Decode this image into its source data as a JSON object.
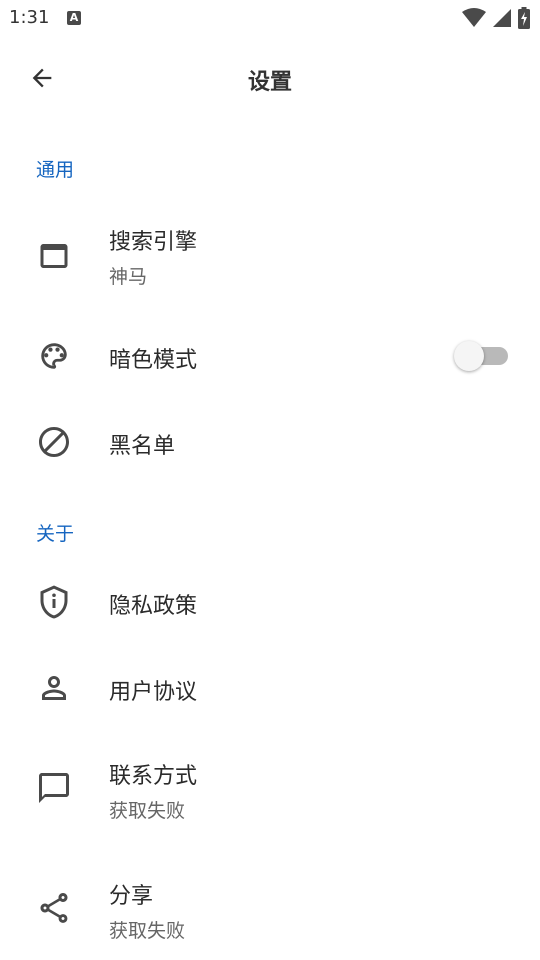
{
  "status_bar": {
    "time": "1:31",
    "notification_icon_letter": "A",
    "icons": [
      "wifi-icon",
      "cell-signal-icon",
      "battery-charging-icon"
    ]
  },
  "app_bar": {
    "title": "设置",
    "back_icon": "arrow-back-icon"
  },
  "sections": {
    "general": {
      "header": "通用",
      "items": {
        "search_engine": {
          "title": "搜索引擎",
          "subtitle": "神马",
          "icon": "browser-window-icon"
        },
        "dark_mode": {
          "title": "暗色模式",
          "icon": "palette-icon",
          "toggle_on": false
        },
        "blacklist": {
          "title": "黑名单",
          "icon": "block-icon"
        }
      }
    },
    "about": {
      "header": "关于",
      "items": {
        "privacy_policy": {
          "title": "隐私政策",
          "icon": "shield-info-icon"
        },
        "user_agreement": {
          "title": "用户协议",
          "icon": "person-icon"
        },
        "contact": {
          "title": "联系方式",
          "subtitle": "获取失败",
          "icon": "chat-bubble-icon"
        },
        "share": {
          "title": "分享",
          "subtitle": "获取失败",
          "icon": "share-icon"
        }
      }
    }
  },
  "colors": {
    "accent": "#1565c0",
    "text_primary": "#2b2b2b",
    "text_secondary": "#666666",
    "icon": "#4a4a4a",
    "toggle_track_off": "#b9b9b9",
    "toggle_thumb_off": "#f5f5f5"
  }
}
